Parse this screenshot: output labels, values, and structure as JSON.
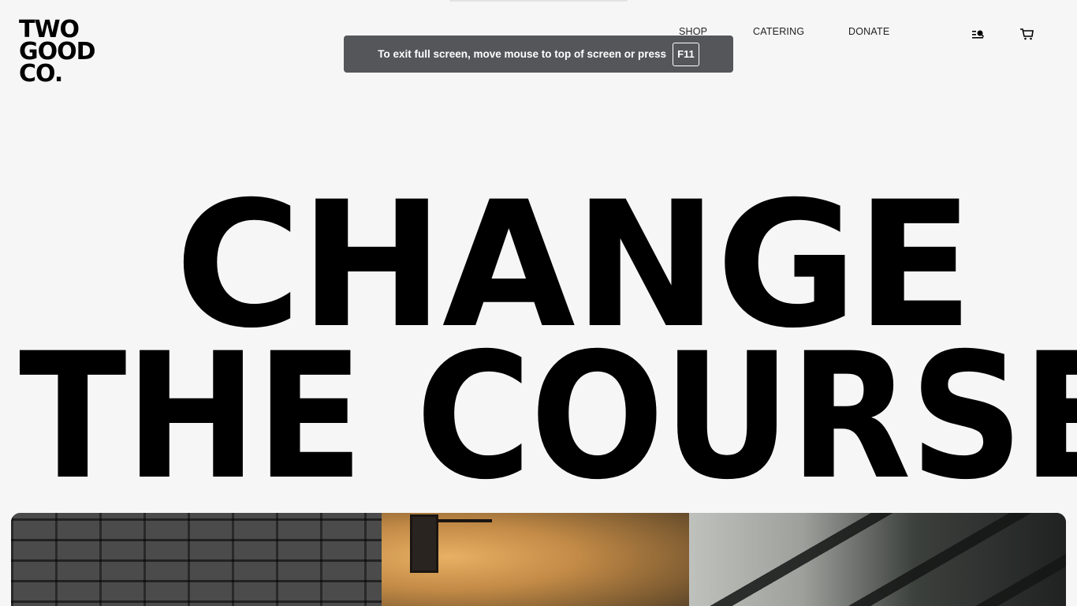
{
  "brand": {
    "logo_lines": [
      "TWO",
      "GOOD",
      "CO."
    ]
  },
  "nav": {
    "items": [
      {
        "label": "SHOP"
      },
      {
        "label": "CATERING"
      },
      {
        "label": "DONATE"
      }
    ],
    "icons": {
      "menu": "menu-search-icon",
      "cart": "cart-icon"
    }
  },
  "fullscreen_toast": {
    "message": "To exit full screen, move mouse to top of screen or press",
    "key": "F11"
  },
  "hero": {
    "line1": "CHANGE",
    "line2": "THE COURSE"
  },
  "colors": {
    "background": "#f6f6f6",
    "text": "#000000",
    "toast_bg": "#54565a"
  }
}
